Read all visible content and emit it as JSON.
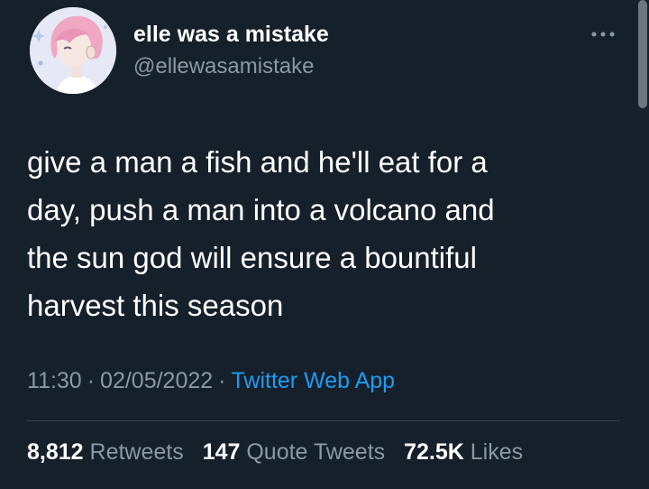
{
  "author": {
    "display_name": "elle was a mistake",
    "handle": "@ellewasamistake"
  },
  "tweet": {
    "text": "give a man a fish and he'll eat for a\nday, push a man into a volcano and\nthe sun god will ensure a bountiful\nharvest this season",
    "time": "11:30",
    "separator": "·",
    "date": "02/05/2022",
    "source": "Twitter Web App"
  },
  "stats": {
    "retweets_count": "8,812",
    "retweets_label": "Retweets",
    "quotes_count": "147",
    "quotes_label": "Quote Tweets",
    "likes_count": "72.5K",
    "likes_label": "Likes"
  },
  "icons": {
    "more": "more-horizontal-icon",
    "avatar": "avatar-illustration"
  },
  "colors": {
    "background": "#15202b",
    "text_primary": "#ffffff",
    "text_secondary": "#8b98a5",
    "link": "#1d9bf0",
    "divider": "#38444d"
  }
}
